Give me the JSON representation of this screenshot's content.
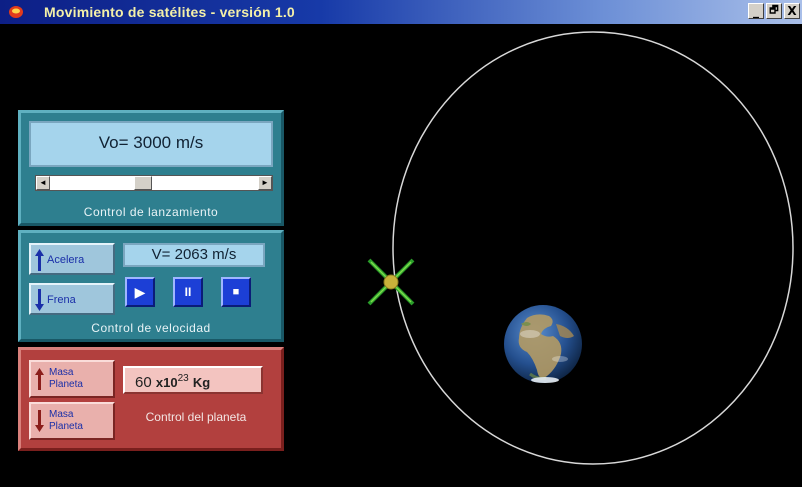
{
  "window": {
    "title": "Movimiento de satélites - versión 1.0",
    "controls": [
      "_",
      "🗗",
      "X"
    ]
  },
  "launch_panel": {
    "readout_prefix": "Vo=",
    "readout_value": "3000",
    "readout_unit": "m/s",
    "label": "Control de lanzamiento",
    "scroll_left": "◄",
    "scroll_right": "►"
  },
  "velocity_panel": {
    "accelerate_label": "Acelera",
    "brake_label": "Frena",
    "readout_prefix": "V=",
    "readout_value": "2063",
    "readout_unit": "m/s",
    "label": "Control de velocidad",
    "play_icon": "▶",
    "pause_icon": "II",
    "stop_icon": "■"
  },
  "planet_panel": {
    "mass_up_line1": "Masa",
    "mass_up_line2": "Planeta",
    "mass_down_line1": "Masa",
    "mass_down_line2": "Planeta",
    "mass_value": "60",
    "mass_multiplier": "x10",
    "mass_exponent": "23",
    "mass_unit": "Kg",
    "label": "Control del planeta"
  },
  "colors": {
    "title_gradient_start": "#0d1f86",
    "title_text": "#f4f0a8",
    "teal_panel": "#2e7f8f",
    "red_panel": "#b2403e",
    "lcd_blue": "#a5d4ec",
    "media_button": "#1c3fd6",
    "orbit": "#d8d8d8"
  }
}
